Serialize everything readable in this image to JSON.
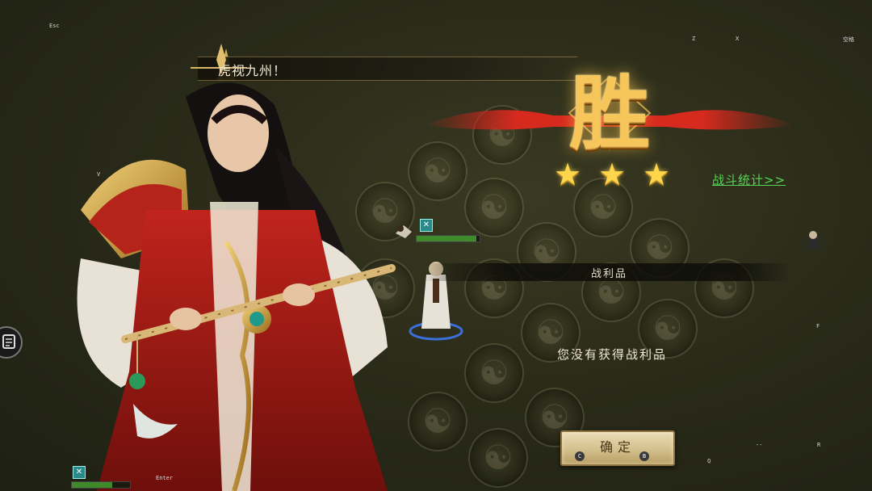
{
  "hero": {
    "quote": "虎视九州！"
  },
  "victory": {
    "title": "胜",
    "stars_earned": 3,
    "stars_total": 3,
    "battle_stats_link": "战斗统计>>"
  },
  "loot": {
    "header": "战利品",
    "message": "您没有获得战利品"
  },
  "confirm": {
    "label": "确定",
    "key_left": "C",
    "key_right": "B"
  },
  "key_hints": {
    "esc": "Esc",
    "z": "Z",
    "x": "X",
    "space": "空格",
    "v": "V",
    "f": "F",
    "enter": "Enter",
    "q": "Q",
    "r": "R",
    "dash": "--"
  },
  "units": {
    "ally": {
      "badge": "✕",
      "hp": 0.95
    },
    "bottom": {
      "badge": "✕",
      "hp": 0.7
    }
  },
  "colors": {
    "victory_gold": "#f7c65a",
    "stats_link": "#56d654",
    "button_face": "#d4c08e",
    "ribbon_red": "#c8201a"
  }
}
